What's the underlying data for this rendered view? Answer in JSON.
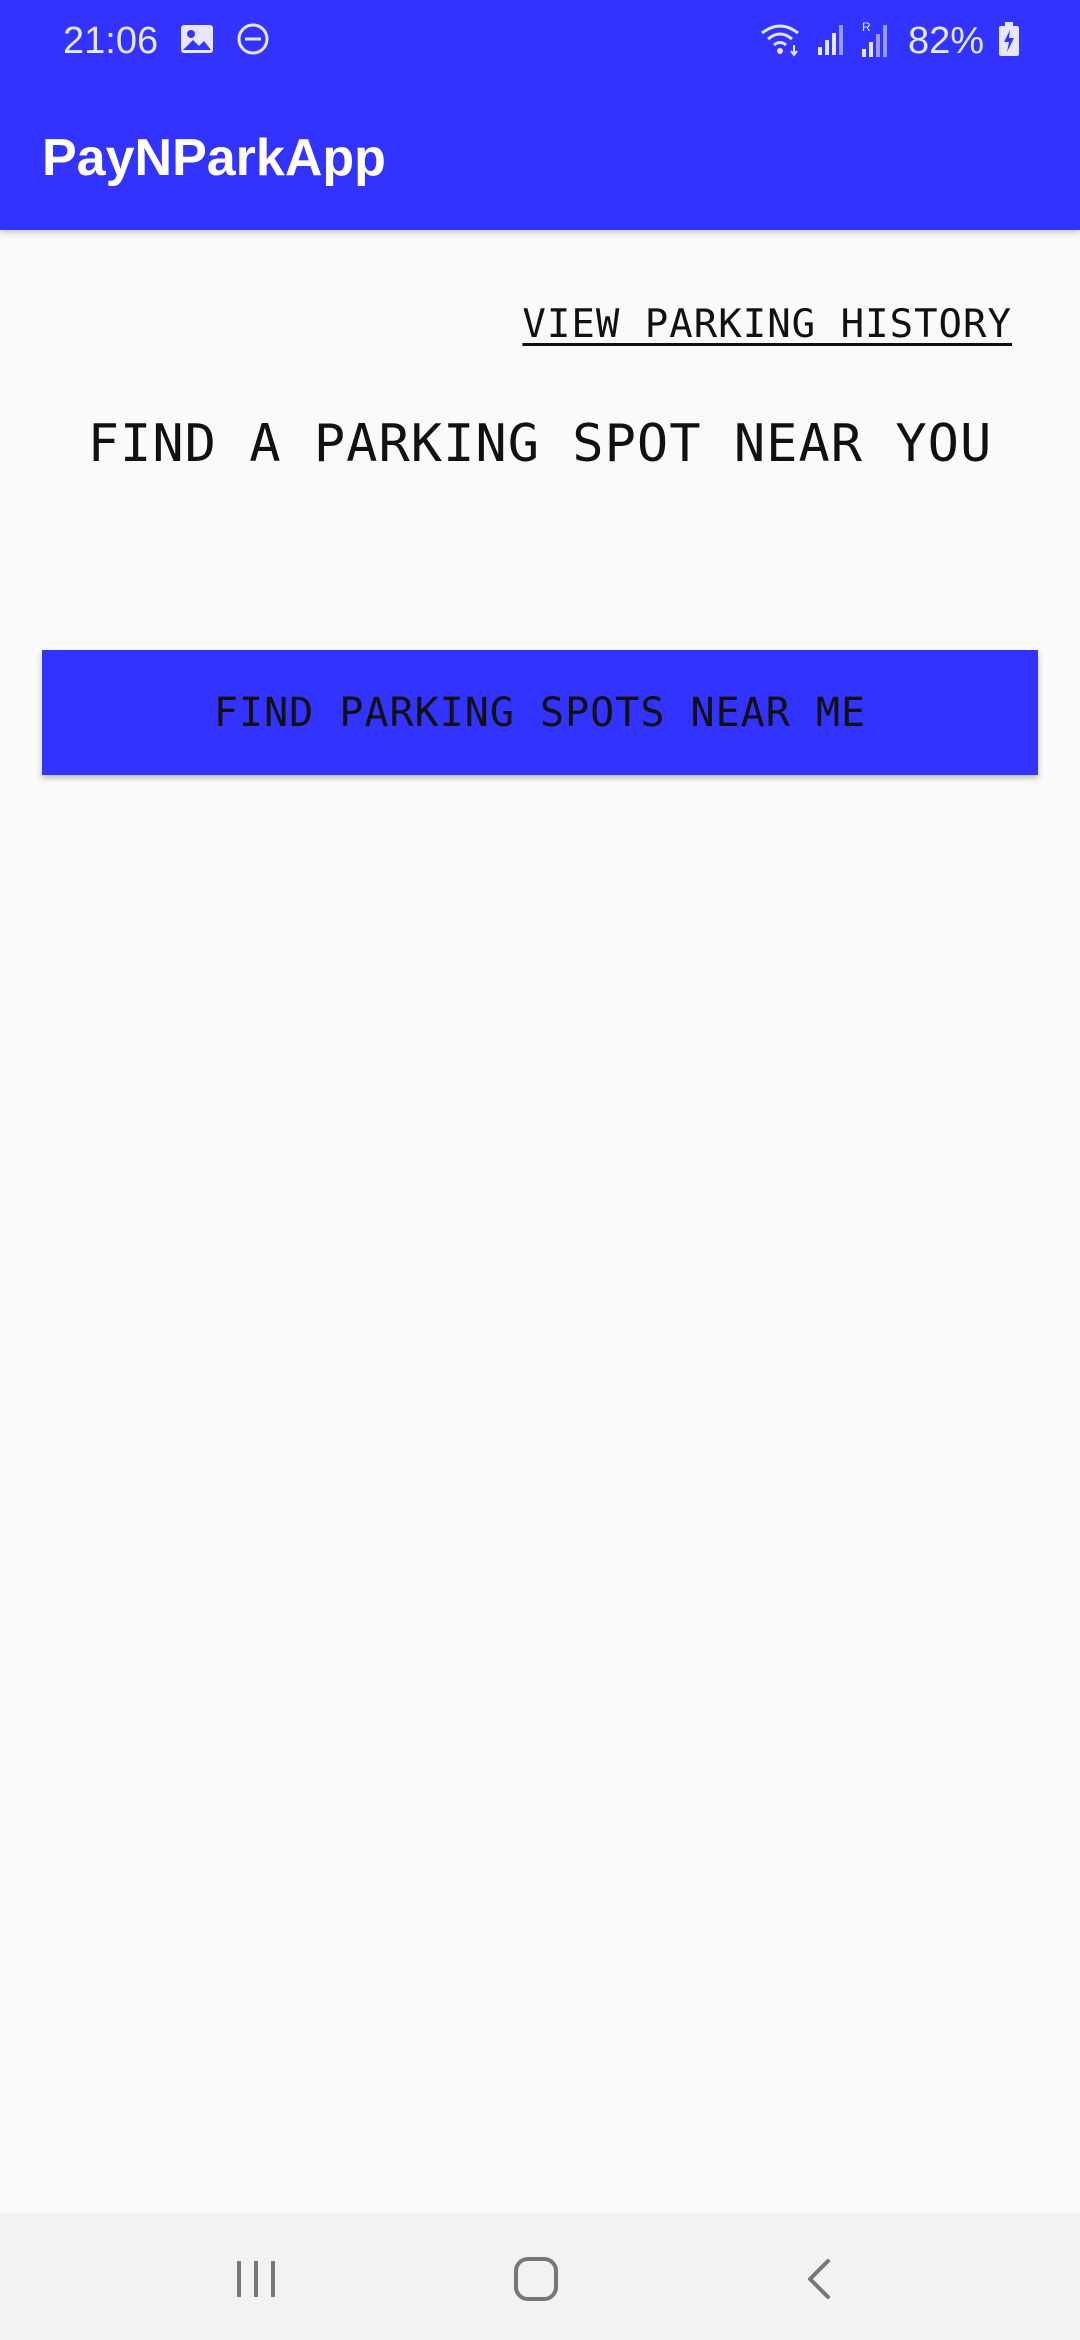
{
  "status_bar": {
    "time": "21:06",
    "battery": "82%",
    "icons": [
      "gallery-icon",
      "do-not-disturb-icon",
      "wifi-icon",
      "signal-icon",
      "signal-roaming-icon",
      "battery-charging-icon"
    ],
    "color": "#3333ff"
  },
  "app_bar": {
    "title": "PayNParkApp",
    "color": "#3333ff"
  },
  "main": {
    "history_link": "VIEW PARKING HISTORY",
    "heading": "FIND A PARKING SPOT NEAR YOU",
    "find_button": "FIND PARKING SPOTS NEAR ME",
    "button_color": "#3333ff"
  },
  "nav_bar": {
    "items": [
      "recent-apps-icon",
      "home-icon",
      "back-icon"
    ]
  }
}
